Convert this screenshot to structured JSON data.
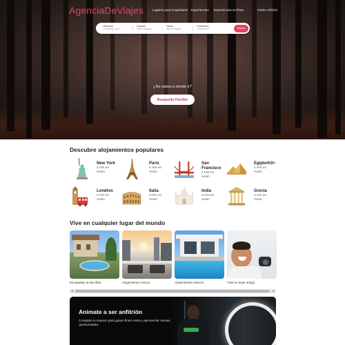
{
  "brand": {
    "name": "AgenciaDeViajes",
    "accent": "#e2435e"
  },
  "nav": {
    "links": [
      "Lugares para hospedarse",
      "Experiencias",
      "Experiencias en línea"
    ],
    "host_link": "Hazte Anfitrión"
  },
  "search": {
    "fields": [
      {
        "label": "Ubicación",
        "value": "¿A dónde vas?"
      },
      {
        "label": "Llegada",
        "value": "dd/mm/aaaa"
      },
      {
        "label": "Salida",
        "value": "dd/mm/aaaa"
      },
      {
        "label": "Huéspedes",
        "value": "¿Cuántos?"
      }
    ],
    "button": "Buscar"
  },
  "hero": {
    "question": "¿No sabes a donde ir?",
    "button": "Busqueda Flexible"
  },
  "popular": {
    "title": "Descubre alojamientos populares",
    "items": [
      {
        "name": "New York",
        "info": "4 Hrs en Avion",
        "icon": "statue-of-liberty-icon"
      },
      {
        "name": "Paris",
        "info": "4 Hrs en Avion",
        "icon": "eiffel-tower-icon"
      },
      {
        "name": "San Francisco",
        "info": "4 Hrs en Avion",
        "icon": "golden-gate-bridge-icon"
      },
      {
        "name": "Egipto/h3>",
        "info": "4 Hrs en Avion",
        "icon": "pyramids-icon"
      },
      {
        "name": "Londres",
        "info": "4 Hrs en Avion",
        "icon": "big-ben-bus-icon"
      },
      {
        "name": "Italia",
        "info": "4 Hrs en Avion",
        "icon": "colosseum-icon"
      },
      {
        "name": "India",
        "info": "4 Hrs en Avion",
        "icon": "taj-mahal-icon"
      },
      {
        "name": "Grecia",
        "info": "4 Hrs en Avion",
        "icon": "greek-temple-icon"
      }
    ]
  },
  "anywhere": {
    "title": "Vive en cualquier lugar del mundo",
    "cards": [
      {
        "caption": "Escapadas al aire libre"
      },
      {
        "caption": "Alojamientos únicos"
      },
      {
        "caption": "Alojamientos enteros"
      },
      {
        "caption": "Trae tu mejor amigo"
      }
    ]
  },
  "host": {
    "title": "Animate a ser anfitrión",
    "text": "Comparte tu espacio para ganar dinero extra y aprovechar nuevas oportunidades"
  }
}
